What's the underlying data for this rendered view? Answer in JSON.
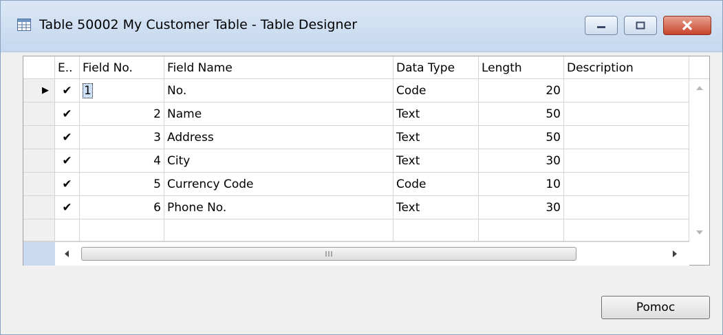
{
  "window": {
    "title": "Table 50002 My Customer Table - Table Designer",
    "icon": "table-icon"
  },
  "grid": {
    "headers": {
      "enabled": "E..",
      "field_no": "Field No.",
      "field_name": "Field Name",
      "data_type": "Data Type",
      "length": "Length",
      "description": "Description"
    },
    "rows": [
      {
        "enabled": "✔",
        "field_no": "1",
        "field_name": "No.",
        "data_type": "Code",
        "length": "20",
        "description": ""
      },
      {
        "enabled": "✔",
        "field_no": "2",
        "field_name": "Name",
        "data_type": "Text",
        "length": "50",
        "description": ""
      },
      {
        "enabled": "✔",
        "field_no": "3",
        "field_name": "Address",
        "data_type": "Text",
        "length": "50",
        "description": ""
      },
      {
        "enabled": "✔",
        "field_no": "4",
        "field_name": "City",
        "data_type": "Text",
        "length": "30",
        "description": ""
      },
      {
        "enabled": "✔",
        "field_no": "5",
        "field_name": "Currency Code",
        "data_type": "Code",
        "length": "10",
        "description": ""
      },
      {
        "enabled": "✔",
        "field_no": "6",
        "field_name": "Phone No.",
        "data_type": "Text",
        "length": "30",
        "description": ""
      }
    ],
    "current_row_marker": "▶"
  },
  "buttons": {
    "help_label": "Pomoc"
  },
  "colors": {
    "title_gradient_top": "#dbe7f5",
    "close_button": "#c7452b",
    "grid_line": "#d4d4d4"
  }
}
